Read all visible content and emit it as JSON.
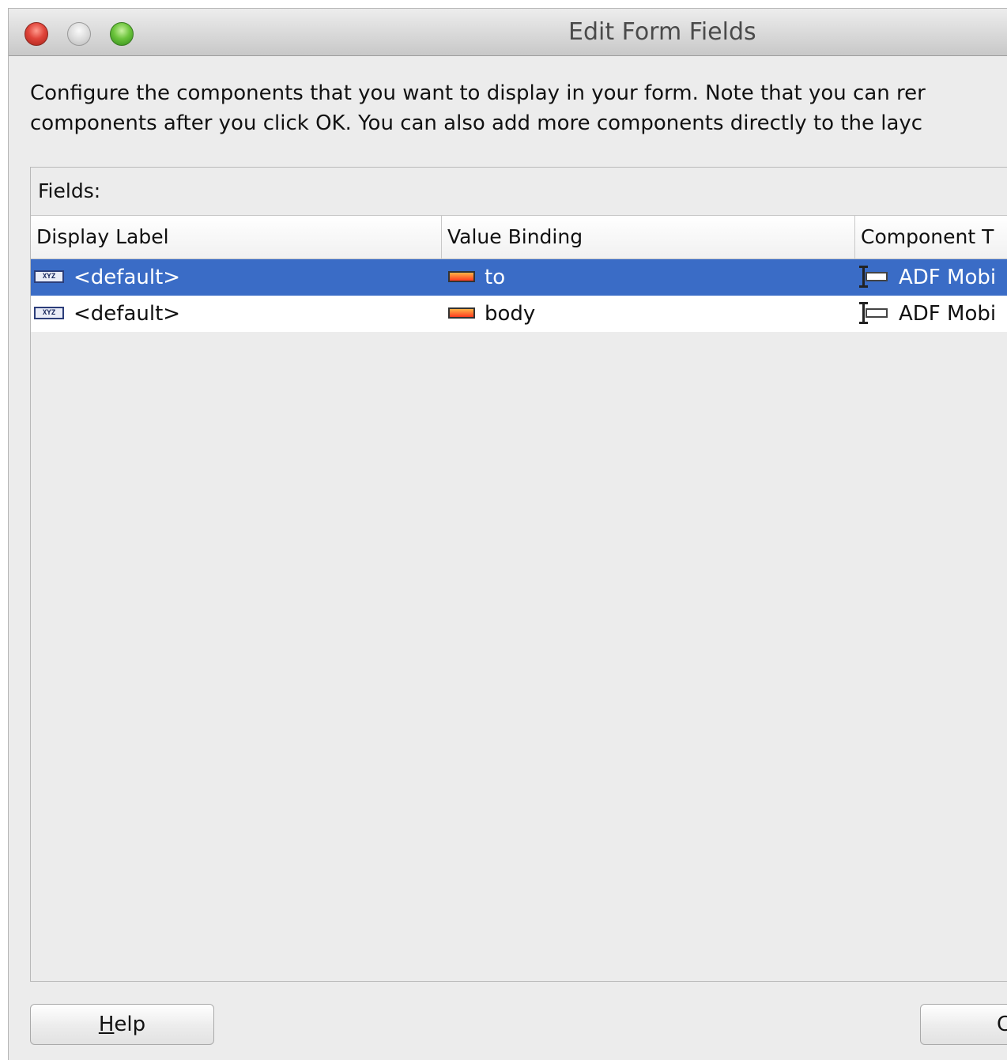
{
  "window": {
    "title": "Edit Form Fields"
  },
  "intro": {
    "line1": "Configure the components that you want to display in your form.  Note that you can rer",
    "line2": "components after you click OK.  You can also add more components directly to the layc"
  },
  "fields": {
    "label": "Fields:",
    "columns": [
      "Display Label",
      "Value Binding",
      "Component T"
    ],
    "rows": [
      {
        "display_label": "<default>",
        "value_binding": "to",
        "component_type": "ADF Mobi",
        "selected": true
      },
      {
        "display_label": "<default>",
        "value_binding": "body",
        "component_type": "ADF Mobi",
        "selected": false
      }
    ]
  },
  "buttons": {
    "help_mnemonic": "H",
    "help_rest": "elp",
    "ok_visible": "C"
  },
  "icons": {
    "display_label_icon": "xyz-text-icon",
    "value_binding_icon": "attribute-binding-icon",
    "component_icon": "input-text-component-icon"
  },
  "colors": {
    "selection": "#3a6cc6",
    "window_bg": "#ececec"
  }
}
